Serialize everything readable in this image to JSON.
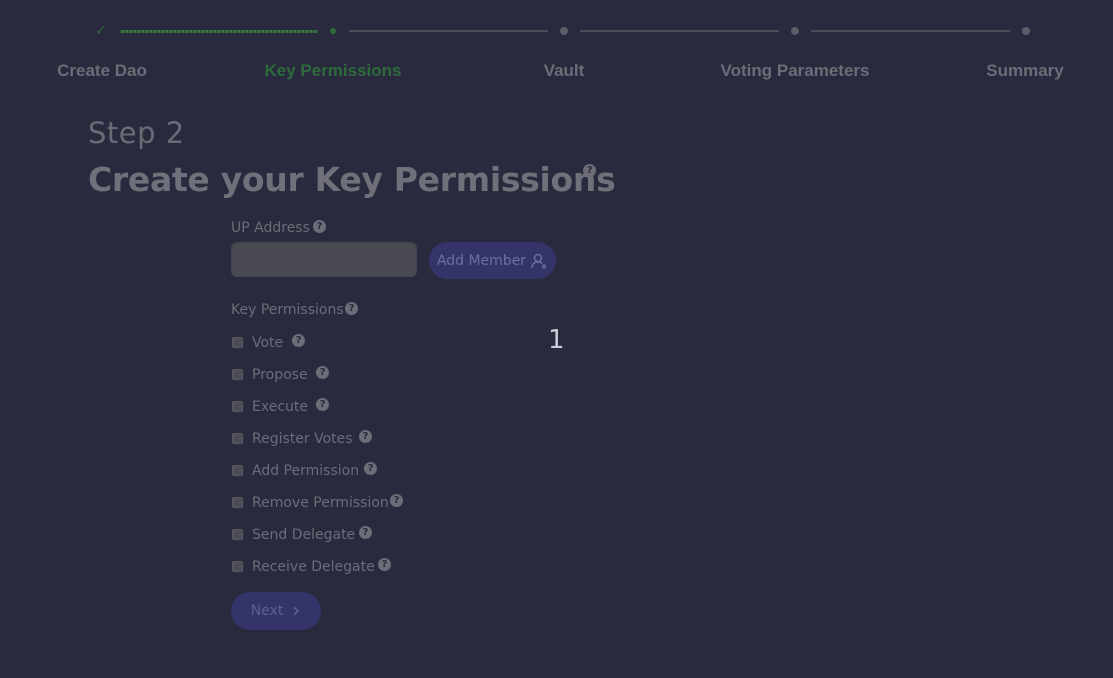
{
  "stepper": {
    "steps": [
      {
        "label": "Create Dao",
        "state": "completed"
      },
      {
        "label": "Key Permissions",
        "state": "current"
      },
      {
        "label": "Vault",
        "state": "upcoming"
      },
      {
        "label": "Voting Parameters",
        "state": "upcoming"
      },
      {
        "label": "Summary",
        "state": "upcoming"
      }
    ],
    "check_glyph": "✓"
  },
  "header": {
    "step": "Step 2",
    "title": "Create your Key Permissions",
    "help_glyph": "?"
  },
  "up_address": {
    "label": "UP Address",
    "value": "",
    "placeholder": ""
  },
  "add_member": {
    "label": "Add Member",
    "icon": "add-user-icon"
  },
  "key_permissions": {
    "label": "Key Permissions",
    "options": [
      {
        "label": "Vote",
        "checked": false
      },
      {
        "label": "Propose",
        "checked": false
      },
      {
        "label": "Execute",
        "checked": false
      },
      {
        "label": "Register Votes",
        "checked": false
      },
      {
        "label": "Add Permission",
        "checked": false
      },
      {
        "label": "Remove Permission",
        "checked": false
      },
      {
        "label": "Send Delegate",
        "checked": false
      },
      {
        "label": "Receive Delegate",
        "checked": false
      }
    ]
  },
  "member_count": "1",
  "next": {
    "label": "Next",
    "icon": "chevron-right-icon"
  },
  "colors": {
    "background": "#292a3e",
    "accent": "#34336a",
    "completed": "#2e6b3c",
    "muted_text": "#6c6d76"
  }
}
